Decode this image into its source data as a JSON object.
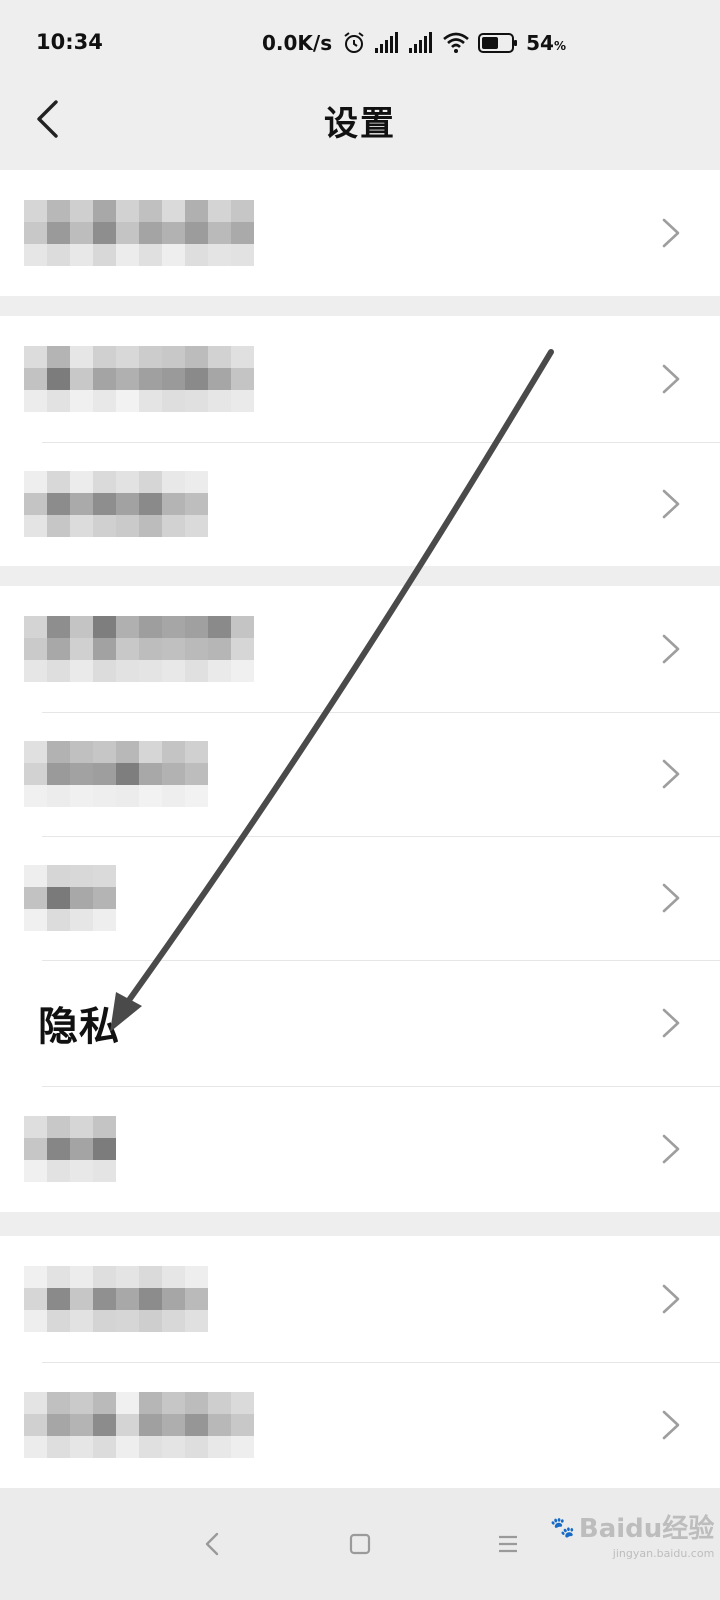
{
  "status_bar": {
    "time": "10:34",
    "net_speed": "0.0K/s",
    "battery_percent": "54",
    "battery_unit": "%",
    "icons": [
      "alarm-icon",
      "signal-icon",
      "signal-icon",
      "wifi-icon",
      "battery-icon"
    ]
  },
  "header": {
    "title": "设置",
    "back_icon": "chevron-left-icon"
  },
  "rows": {
    "privacy_label": "隐私"
  },
  "annotation": {
    "type": "arrow",
    "color": "#4a4a4a",
    "points_to": "privacy-row"
  },
  "nav_bar": {
    "icons": [
      "back-icon",
      "home-icon",
      "menu-icon"
    ]
  },
  "watermark": {
    "brand": "Baidu经验",
    "url": "jingyan.baidu.com"
  },
  "colors": {
    "page_bg": "#eeeeee",
    "card_bg": "#ffffff",
    "chevron": "#9e9e9e",
    "text": "#111111"
  }
}
